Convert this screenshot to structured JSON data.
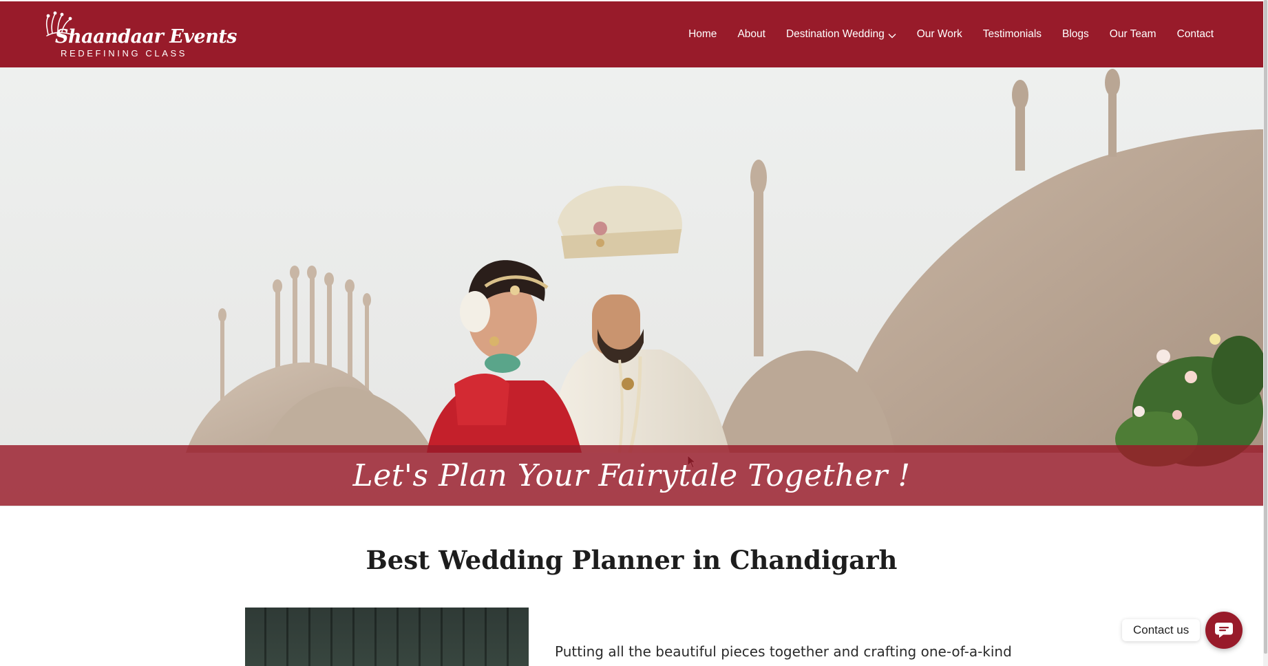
{
  "brand": {
    "name": "Shaandaar Events",
    "tagline": "REDEFINING CLASS",
    "primary_color": "#981b2a"
  },
  "nav": {
    "items": [
      {
        "label": "Home"
      },
      {
        "label": "About"
      },
      {
        "label": "Destination Wedding",
        "icon": "chevron-down-icon"
      },
      {
        "label": "Our Work"
      },
      {
        "label": "Testimonials"
      },
      {
        "label": "Blogs"
      },
      {
        "label": "Our Team"
      },
      {
        "label": "Contact"
      }
    ]
  },
  "hero": {
    "banner_text": "Let's Plan Your Fairytale Together !"
  },
  "content": {
    "heading": "Best Wedding Planner in Chandigarh",
    "paragraph": "Putting all the beautiful pieces together and crafting one-of-a-kind"
  },
  "contact_widget": {
    "label": "Contact us",
    "icon": "chat-bubble-icon"
  }
}
